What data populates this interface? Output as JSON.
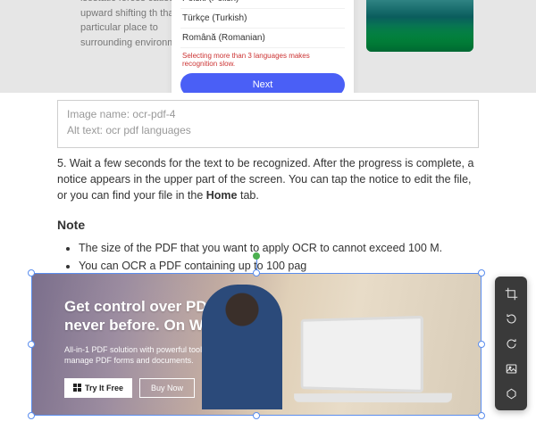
{
  "top": {
    "bg_text": "isostatic forces cause  move upward shifting th that particular place to  surrounding environme",
    "langs": [
      "Polski (Polish)",
      "Türkçe (Turkish)",
      "Română (Romanian)"
    ],
    "hint": "Selecting more than 3 languages makes recognition slow.",
    "next": "Next"
  },
  "meta": {
    "img_name_label": "Image name:",
    "img_name_value": "ocr-pdf-4",
    "alt_label": "Alt text:",
    "alt_value": "ocr pdf languages"
  },
  "step5_a": "5. Wait a few seconds for the text to be recognized. After the progress is complete, a notice appears in the upper part of the screen. You can tap the notice to edit the file, or you can find your file in the ",
  "step5_home": "Home",
  "step5_b": " tab.",
  "note_heading": "Note",
  "bullet1": "The size of the PDF that you want to apply OCR to cannot exceed 100 M.",
  "bullet2": "You can OCR a PDF containing up to 100 pag",
  "promo": {
    "title_l1": "Get control over PDFs like",
    "title_l2": "never before. On Windows",
    "sub": "All-in-1 PDF solution with powerful tools to reliably create and manage PDF forms and documents.",
    "try": "Try It Free",
    "buy": "Buy Now"
  },
  "toolbar": {
    "crop": "crop",
    "rotate_left": "rotate-left",
    "rotate_right": "rotate-right",
    "replace": "replace-image",
    "more": "more"
  }
}
